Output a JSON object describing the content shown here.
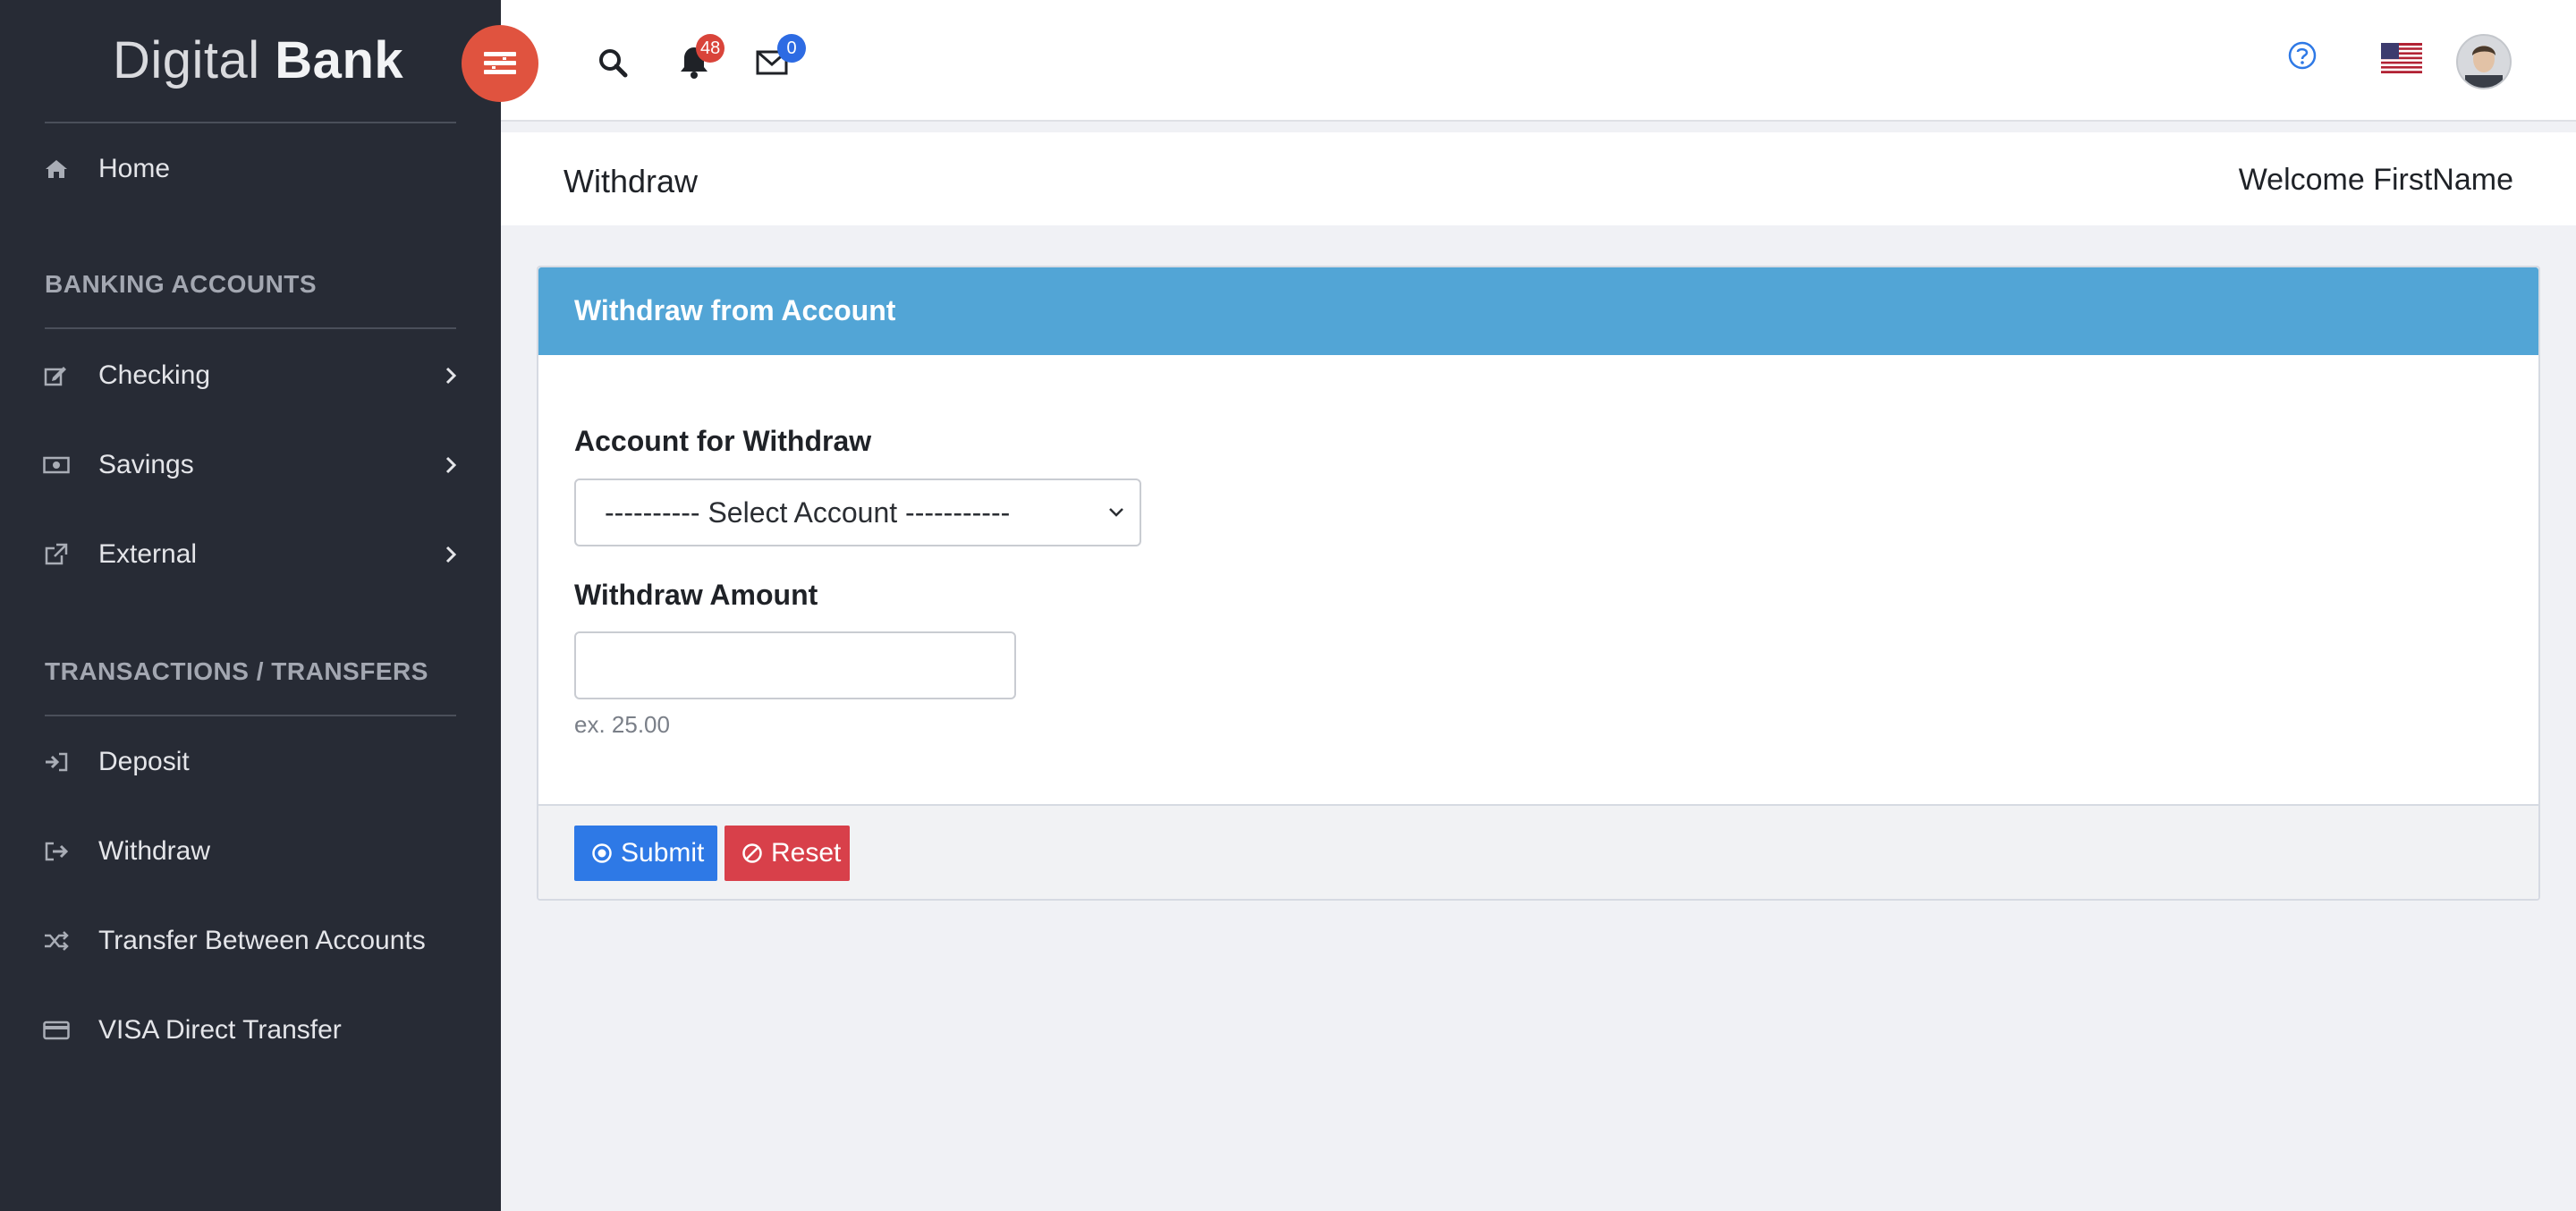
{
  "brand": {
    "light": "Digital",
    "bold": "Bank"
  },
  "sidebar": {
    "home": {
      "label": "Home",
      "icon": "home-icon"
    },
    "sections": [
      {
        "title": "BANKING ACCOUNTS"
      },
      {
        "title": "TRANSACTIONS / TRANSFERS"
      }
    ],
    "accounts": [
      {
        "label": "Checking",
        "icon": "edit-icon"
      },
      {
        "label": "Savings",
        "icon": "money-icon"
      },
      {
        "label": "External",
        "icon": "external-link-icon"
      }
    ],
    "transactions": [
      {
        "label": "Deposit",
        "icon": "sign-in-icon"
      },
      {
        "label": "Withdraw",
        "icon": "sign-out-icon"
      },
      {
        "label": "Transfer Between Accounts",
        "icon": "random-icon"
      },
      {
        "label": "VISA Direct Transfer",
        "icon": "credit-card-icon"
      }
    ]
  },
  "topbar": {
    "notifications_count": "48",
    "messages_count": "0"
  },
  "header": {
    "title": "Withdraw",
    "welcome": "Welcome FirstName"
  },
  "form": {
    "card_title": "Withdraw from Account",
    "account_label": "Account for Withdraw",
    "account_selected": "---------- Select Account -----------",
    "amount_label": "Withdraw Amount",
    "amount_value": "",
    "amount_hint": "ex. 25.00",
    "submit_label": "Submit",
    "reset_label": "Reset"
  },
  "colors": {
    "sidebar_bg": "#272b35",
    "toggle": "#e0533f",
    "card_header": "#52a5d6",
    "submit": "#2e79e6",
    "reset": "#d8404a",
    "badge_red": "#d9443a",
    "badge_blue": "#2d6be3"
  }
}
